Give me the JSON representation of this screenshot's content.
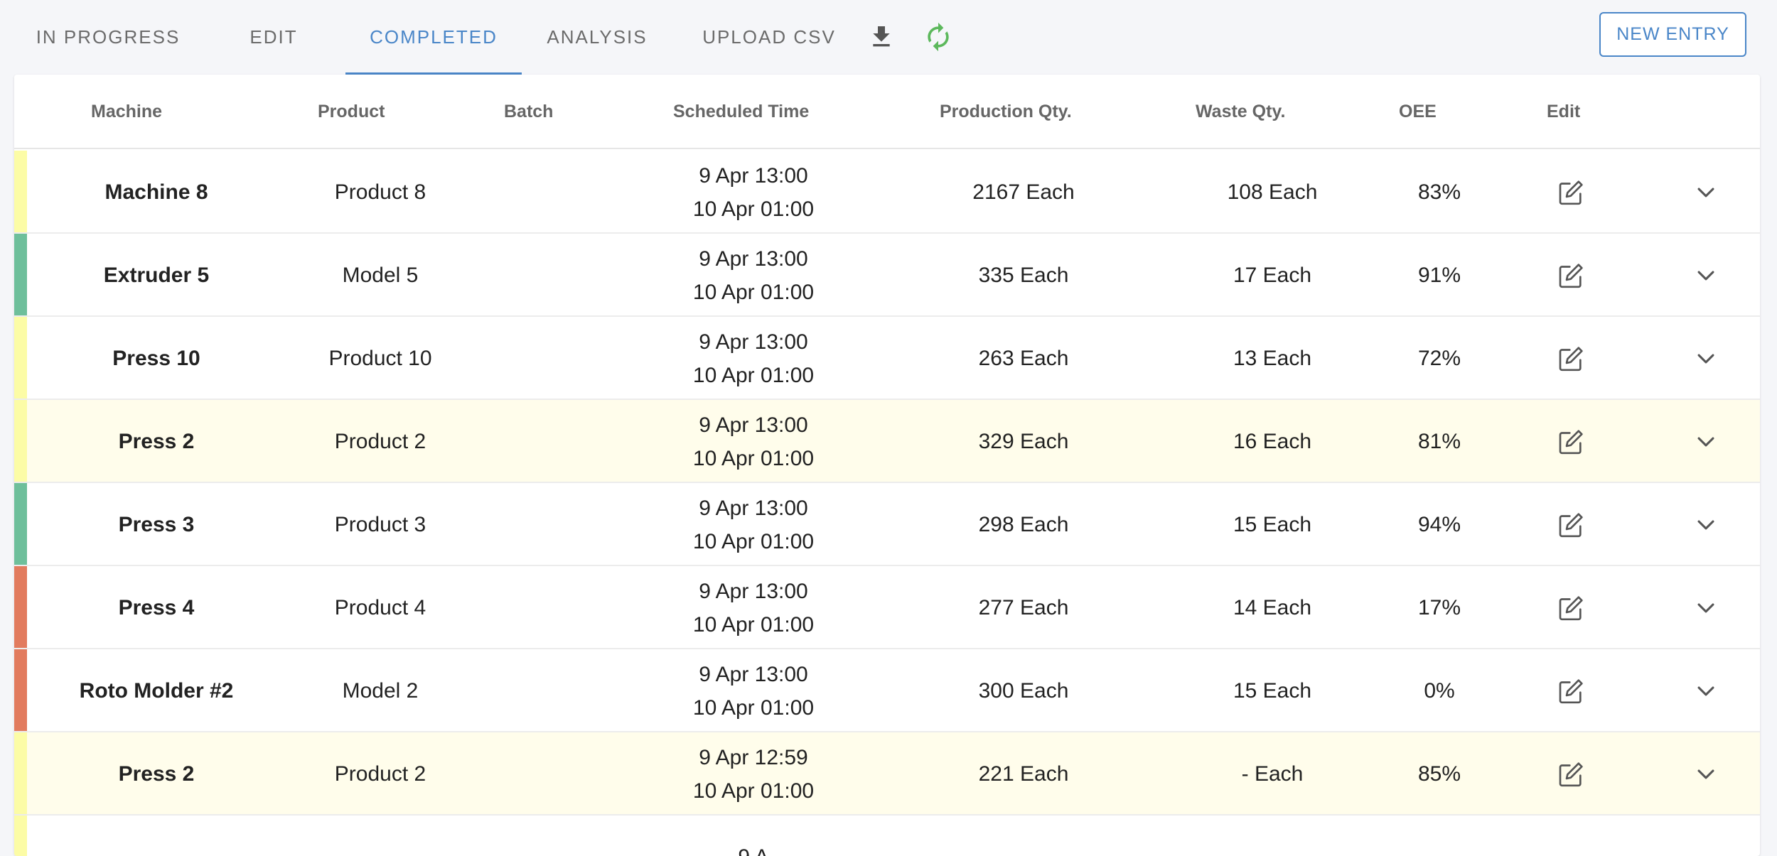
{
  "tabs": [
    {
      "label": "IN PROGRESS",
      "active": false
    },
    {
      "label": "EDIT",
      "active": false
    },
    {
      "label": "COMPLETED",
      "active": true
    },
    {
      "label": "ANALYSIS",
      "active": false
    },
    {
      "label": "UPLOAD CSV",
      "active": false
    }
  ],
  "toolbar": {
    "download_icon": "download-icon",
    "refresh_icon": "refresh-icon",
    "new_entry_label": "NEW ENTRY"
  },
  "colors": {
    "accent": "#4a86c8",
    "status_yellow": "#fcfca6",
    "status_green": "#6ebf9b",
    "status_red": "#e27b5e",
    "refresh_green": "#5cb85c",
    "highlight_row": "#fffdeb"
  },
  "table": {
    "headers": {
      "machine": "Machine",
      "product": "Product",
      "batch": "Batch",
      "scheduled": "Scheduled Time",
      "production": "Production Qty.",
      "waste": "Waste Qty.",
      "oee": "OEE",
      "edit": "Edit"
    },
    "rows": [
      {
        "status": "yellow",
        "highlight": false,
        "machine": "Machine 8",
        "product": "Product 8",
        "batch": "",
        "start": "9 Apr 13:00",
        "end": "10 Apr 01:00",
        "production": "2167 Each",
        "waste": "108 Each",
        "oee": "83%"
      },
      {
        "status": "green",
        "highlight": false,
        "machine": "Extruder 5",
        "product": "Model 5",
        "batch": "",
        "start": "9 Apr 13:00",
        "end": "10 Apr 01:00",
        "production": "335 Each",
        "waste": "17 Each",
        "oee": "91%"
      },
      {
        "status": "yellow",
        "highlight": false,
        "machine": "Press 10",
        "product": "Product 10",
        "batch": "",
        "start": "9 Apr 13:00",
        "end": "10 Apr 01:00",
        "production": "263 Each",
        "waste": "13 Each",
        "oee": "72%"
      },
      {
        "status": "yellow",
        "highlight": true,
        "machine": "Press 2",
        "product": "Product 2",
        "batch": "",
        "start": "9 Apr 13:00",
        "end": "10 Apr 01:00",
        "production": "329 Each",
        "waste": "16 Each",
        "oee": "81%"
      },
      {
        "status": "green",
        "highlight": false,
        "machine": "Press 3",
        "product": "Product 3",
        "batch": "",
        "start": "9 Apr 13:00",
        "end": "10 Apr 01:00",
        "production": "298 Each",
        "waste": "15 Each",
        "oee": "94%"
      },
      {
        "status": "red",
        "highlight": false,
        "machine": "Press 4",
        "product": "Product 4",
        "batch": "",
        "start": "9 Apr 13:00",
        "end": "10 Apr 01:00",
        "production": "277 Each",
        "waste": "14 Each",
        "oee": "17%"
      },
      {
        "status": "red",
        "highlight": false,
        "machine": "Roto Molder #2",
        "product": "Model 2",
        "batch": "",
        "start": "9 Apr 13:00",
        "end": "10 Apr 01:00",
        "production": "300 Each",
        "waste": "15 Each",
        "oee": "0%"
      },
      {
        "status": "yellow",
        "highlight": true,
        "machine": "Press 2",
        "product": "Product 2",
        "batch": "",
        "start": "9 Apr 12:59",
        "end": "10 Apr 01:00",
        "production": "221 Each",
        "waste": "- Each",
        "oee": "85%"
      },
      {
        "status": "yellow",
        "highlight": false,
        "machine": "",
        "product": "",
        "batch": "",
        "start": "9 A",
        "end": "",
        "production": "",
        "waste": "",
        "oee": ""
      }
    ]
  }
}
